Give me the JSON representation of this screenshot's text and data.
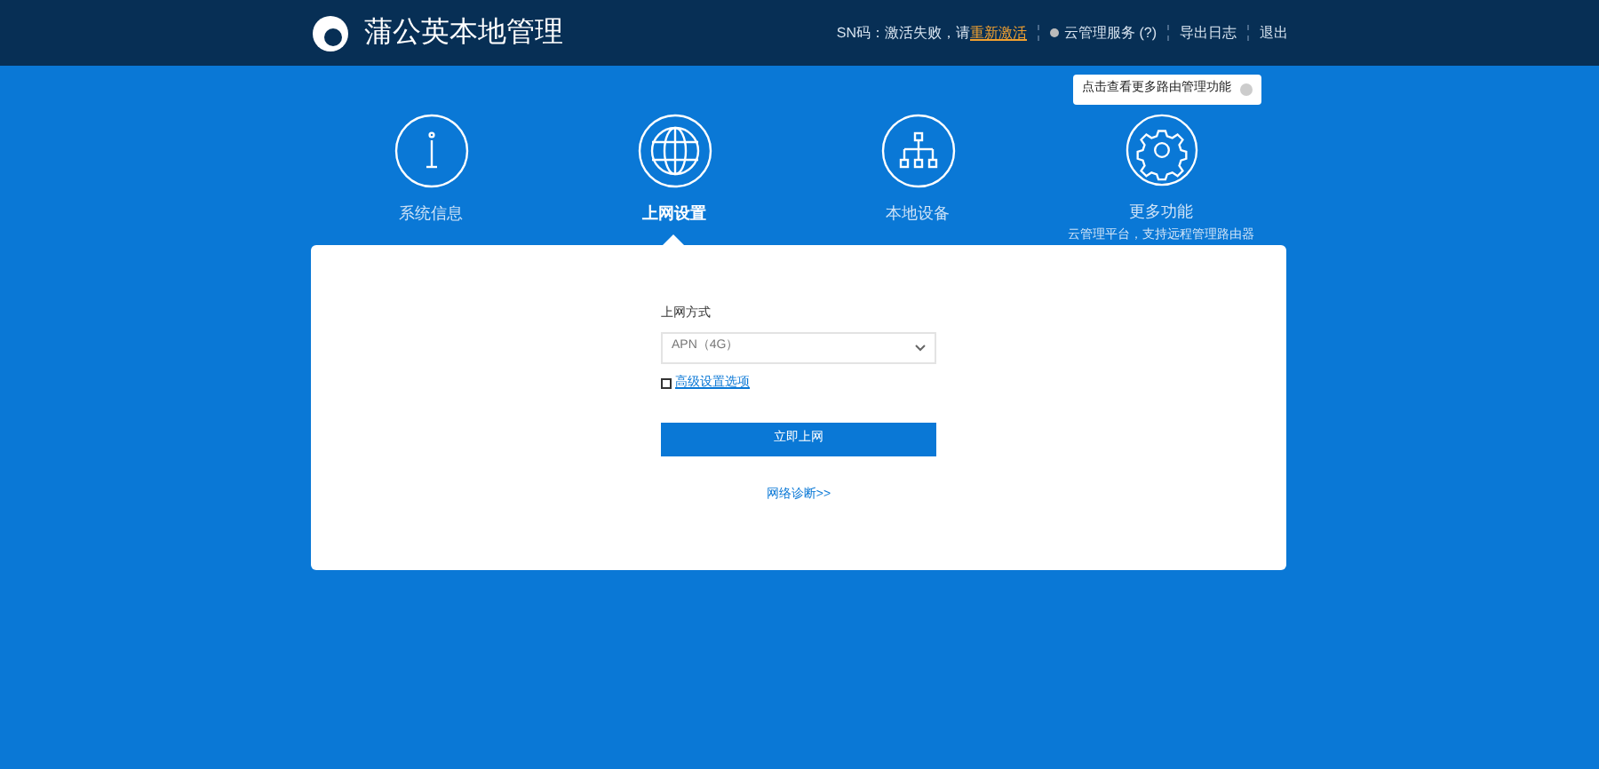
{
  "header": {
    "title": "蒲公英本地管理",
    "sn_label": "SN码：激活失败，请",
    "sn_link": "重新激活",
    "links": [
      {
        "label": "云管理服务 (?)",
        "kind": "status"
      },
      {
        "label": "导出日志",
        "kind": "link"
      },
      {
        "label": "退出",
        "kind": "link"
      }
    ]
  },
  "nav": [
    {
      "label": "系统信息",
      "selected": false
    },
    {
      "label": "上网设置",
      "selected": true
    },
    {
      "label": "本地设备",
      "selected": false
    },
    {
      "label": "更多功能",
      "selected": false,
      "subtitle": "云管理平台，支持远程管理路由器",
      "tooltip": "点击查看更多路由管理功能"
    }
  ],
  "form": {
    "field_label": "上网方式",
    "select_value": "APN（4G）",
    "advanced": {
      "label": "高级设置选项",
      "checked": false
    },
    "submit": "立即上网",
    "diagnose": "网络诊断>>"
  }
}
